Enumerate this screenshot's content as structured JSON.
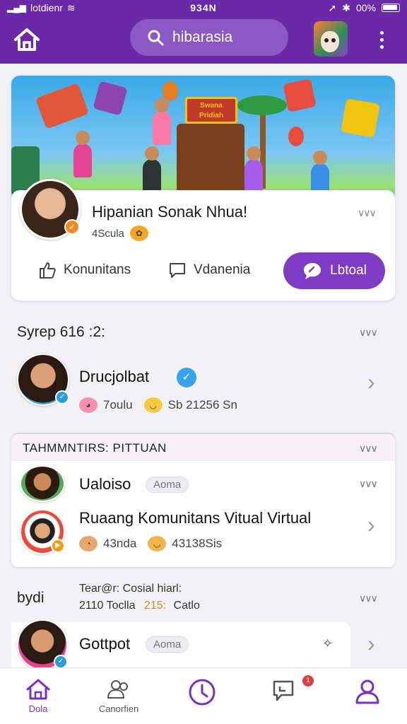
{
  "status_bar": {
    "carrier": "lotdienr",
    "time": "934N",
    "battery": "00%"
  },
  "header": {
    "search_text": "hibarasia"
  },
  "feature": {
    "stage_sign": "Swana Pridiah",
    "name": "Hipanian Sonak Nhua!",
    "sub": "4Scula",
    "actions": [
      {
        "label": "Konunitans",
        "icon": "thumbs-up-icon"
      },
      {
        "label": "Vdanenia",
        "icon": "comment-icon"
      }
    ],
    "cta_label": "Lbtoal"
  },
  "section1": {
    "title": "Syrep 616 :2:",
    "member": {
      "name": "Drucjolbat",
      "stat1": "7oulu",
      "stat2": "Sb 21256 Sn"
    }
  },
  "community": {
    "header": "TAHMMNTIRS: PITTUAN",
    "rows": [
      {
        "name": "Ualoiso",
        "tag": "Aoma"
      },
      {
        "name": "Ruaang Komunitans Vitual Virtual",
        "stat1": "43nda",
        "stat2": "43138Sis"
      }
    ]
  },
  "section2": {
    "title": "bydi",
    "sub_line1": "Tear@r: Cosial hiarl:",
    "sub_line2a": "2110 Toclla",
    "sub_line2b": "215:",
    "sub_line2c": "Catlo",
    "member": {
      "name": "Gottpot",
      "tag": "Aoma"
    }
  },
  "nav": [
    {
      "label": "Dola",
      "icon": "home-icon",
      "active": true
    },
    {
      "label": "Canorfien",
      "icon": "people-icon"
    },
    {
      "label": "",
      "icon": "clock-icon"
    },
    {
      "label": "",
      "icon": "chat-icon",
      "badge": "1"
    },
    {
      "label": "",
      "icon": "profile-icon"
    }
  ],
  "colors": {
    "primary": "#6a2aa8",
    "accent": "#7e3bc3"
  }
}
